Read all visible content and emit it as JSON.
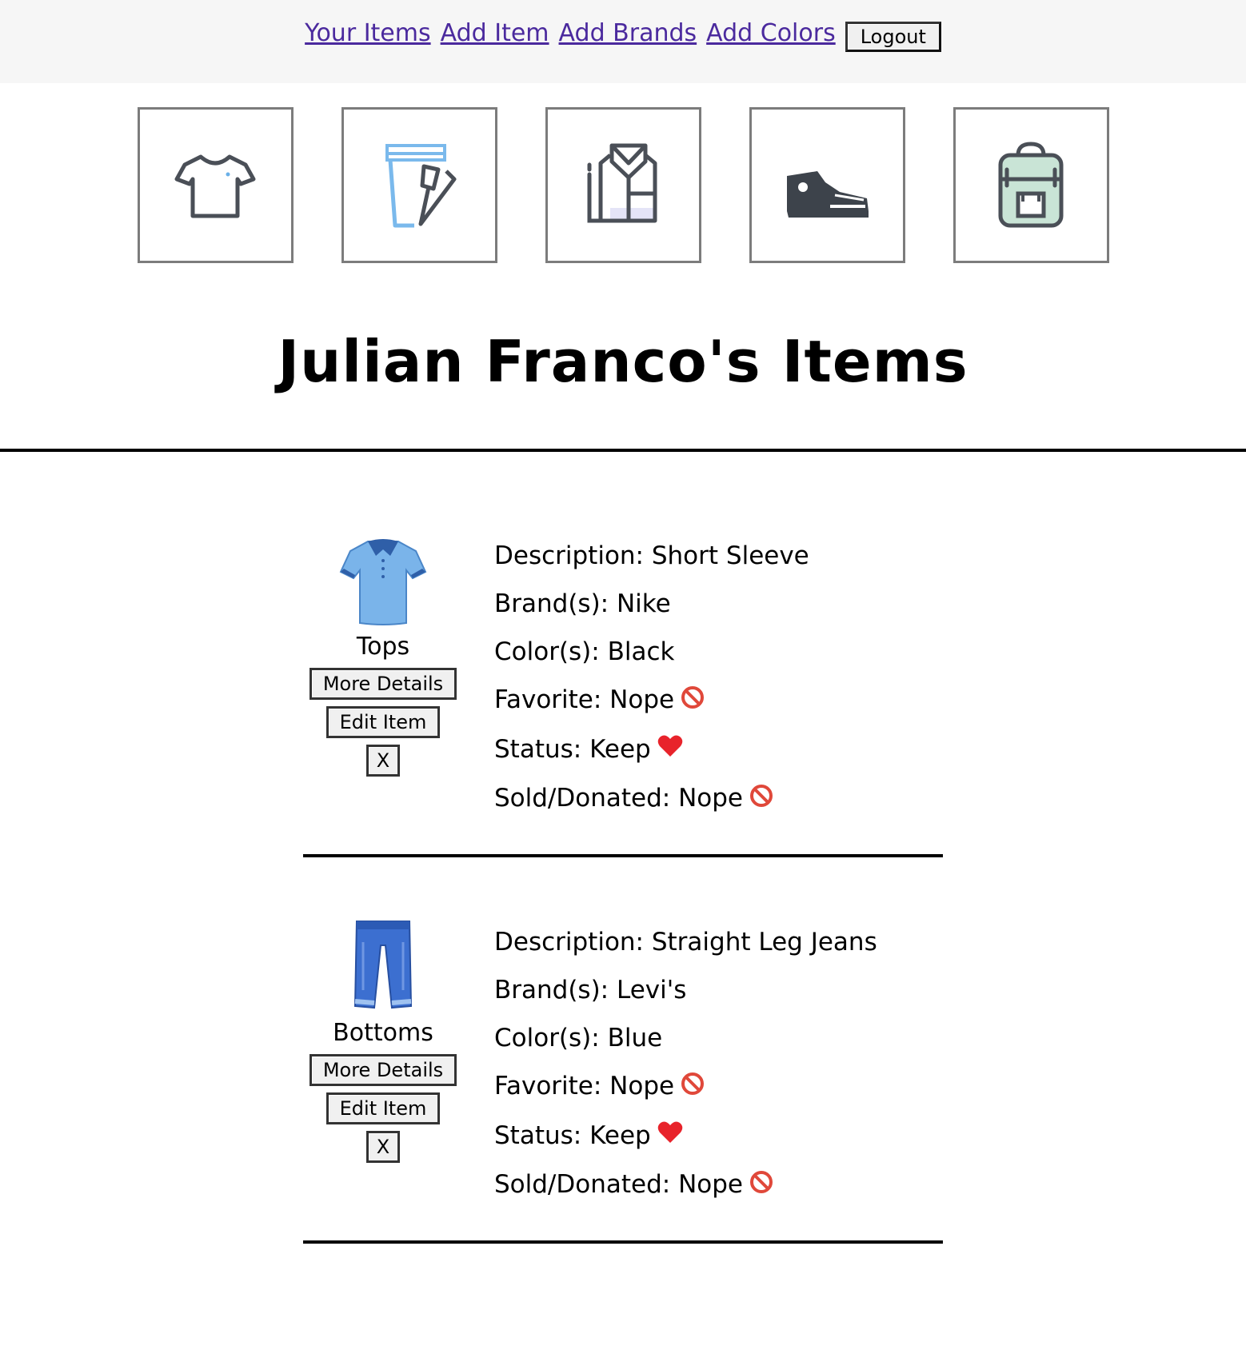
{
  "nav": {
    "links": [
      "Your Items",
      "Add Item",
      "Add Brands",
      "Add Colors"
    ],
    "logout": "Logout"
  },
  "categories": [
    {
      "icon": "tshirt-icon"
    },
    {
      "icon": "pants-icon"
    },
    {
      "icon": "dress-shirt-icon"
    },
    {
      "icon": "sneaker-icon"
    },
    {
      "icon": "backpack-icon"
    }
  ],
  "page_title": "Julian Franco's Items",
  "items": [
    {
      "category": "Tops",
      "icon": "polo-shirt-icon",
      "buttons": {
        "details": "More Details",
        "edit": "Edit Item",
        "delete": "X"
      },
      "description": "Description: Short Sleeve",
      "brands": "Brand(s): Nike",
      "colors": "Color(s): Black",
      "favorite": "Favorite: Nope",
      "status": "Status: Keep",
      "sold": "Sold/Donated: Nope"
    },
    {
      "category": "Bottoms",
      "icon": "jeans-icon",
      "buttons": {
        "details": "More Details",
        "edit": "Edit Item",
        "delete": "X"
      },
      "description": "Description: Straight Leg Jeans",
      "brands": "Brand(s): Levi's",
      "colors": "Color(s): Blue",
      "favorite": "Favorite: Nope",
      "status": "Status: Keep",
      "sold": "Sold/Donated: Nope"
    }
  ],
  "colors": {
    "link": "#4b2a9e",
    "no_symbol": "#e0483a",
    "heart": "#e8232b"
  }
}
